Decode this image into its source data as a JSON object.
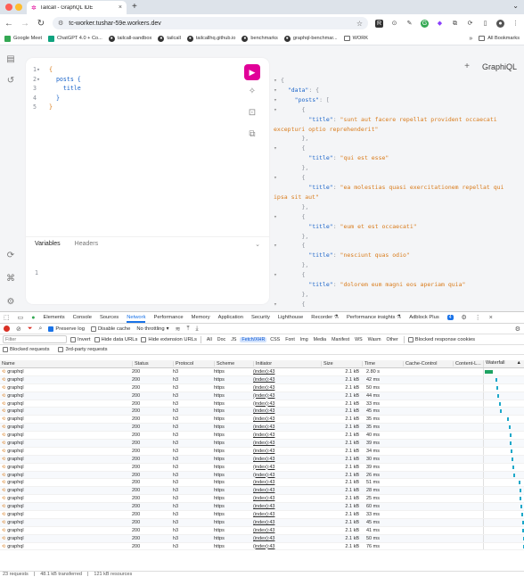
{
  "browser": {
    "tab_title": "Tailcall - GraphQL IDE",
    "new_tab": "+",
    "url": "tc-worker.tushar-59e.workers.dev",
    "bookmarks": [
      "Google Meet",
      "ChatGPT 4.0 + Co...",
      "tailcall-sandbox",
      "tailcall",
      "tailcallhq.github.io",
      "benchmarks",
      "graphql-benchmar...",
      "WORK"
    ],
    "all_bookmarks": "All Bookmarks",
    "colors": {
      "close": "#ff5f57",
      "min": "#febc2e",
      "max": "#28c840",
      "accent": "#e10098"
    }
  },
  "graphiql": {
    "brand": "GraphiQL",
    "add_tab": "+",
    "run_icon": "▶",
    "query_lines": [
      {
        "num": "1",
        "fold": "▾",
        "text": "{",
        "kind": "brace",
        "indent": ""
      },
      {
        "num": "2",
        "fold": "▾",
        "text": "posts {",
        "kind": "field",
        "indent": "  "
      },
      {
        "num": "3",
        "fold": "",
        "text": "title",
        "kind": "field",
        "indent": "    "
      },
      {
        "num": "4",
        "fold": "",
        "text": "}",
        "kind": "field",
        "indent": "  "
      },
      {
        "num": "5",
        "fold": "",
        "text": "}",
        "kind": "brace",
        "indent": ""
      }
    ],
    "variables_tab": "Variables",
    "headers_tab": "Headers",
    "variables_line": "1",
    "result_lines": [
      {
        "fold": "▾",
        "indent": "",
        "key": "",
        "val": "",
        "punct": "{"
      },
      {
        "fold": "▾",
        "indent": "  ",
        "key": "\"data\"",
        "val": "",
        "punct": ": {"
      },
      {
        "fold": "▾",
        "indent": "    ",
        "key": "\"posts\"",
        "val": "",
        "punct": ": ["
      },
      {
        "fold": "▾",
        "indent": "      ",
        "key": "",
        "val": "",
        "punct": "{"
      },
      {
        "fold": "",
        "indent": "        ",
        "key": "\"title\"",
        "val": "\"sunt aut facere repellat provident occaecati excepturi optio reprehenderit\"",
        "punct": ": "
      },
      {
        "fold": "",
        "indent": "      ",
        "key": "",
        "val": "",
        "punct": "},"
      },
      {
        "fold": "▾",
        "indent": "      ",
        "key": "",
        "val": "",
        "punct": "{"
      },
      {
        "fold": "",
        "indent": "        ",
        "key": "\"title\"",
        "val": "\"qui est esse\"",
        "punct": ": "
      },
      {
        "fold": "",
        "indent": "      ",
        "key": "",
        "val": "",
        "punct": "},"
      },
      {
        "fold": "▾",
        "indent": "      ",
        "key": "",
        "val": "",
        "punct": "{"
      },
      {
        "fold": "",
        "indent": "        ",
        "key": "\"title\"",
        "val": "\"ea molestias quasi exercitationem repellat qui ipsa sit aut\"",
        "punct": ": "
      },
      {
        "fold": "",
        "indent": "      ",
        "key": "",
        "val": "",
        "punct": "},"
      },
      {
        "fold": "▾",
        "indent": "      ",
        "key": "",
        "val": "",
        "punct": "{"
      },
      {
        "fold": "",
        "indent": "        ",
        "key": "\"title\"",
        "val": "\"eum et est occaecati\"",
        "punct": ": "
      },
      {
        "fold": "",
        "indent": "      ",
        "key": "",
        "val": "",
        "punct": "},"
      },
      {
        "fold": "▾",
        "indent": "      ",
        "key": "",
        "val": "",
        "punct": "{"
      },
      {
        "fold": "",
        "indent": "        ",
        "key": "\"title\"",
        "val": "\"nesciunt quas odio\"",
        "punct": ": "
      },
      {
        "fold": "",
        "indent": "      ",
        "key": "",
        "val": "",
        "punct": "},"
      },
      {
        "fold": "▾",
        "indent": "      ",
        "key": "",
        "val": "",
        "punct": "{"
      },
      {
        "fold": "",
        "indent": "        ",
        "key": "\"title\"",
        "val": "\"dolorem eum magni eos aperiam quia\"",
        "punct": ": "
      },
      {
        "fold": "",
        "indent": "      ",
        "key": "",
        "val": "",
        "punct": "},"
      },
      {
        "fold": "▾",
        "indent": "      ",
        "key": "",
        "val": "",
        "punct": "{"
      },
      {
        "fold": "",
        "indent": "        ",
        "key": "\"title\"",
        "val": "\"magnam facilis autem\"",
        "punct": ": "
      }
    ]
  },
  "devtools": {
    "tabs": [
      "Elements",
      "Console",
      "Sources",
      "Network",
      "Performance",
      "Memory",
      "Application",
      "Security",
      "Lighthouse",
      "Recorder ⚗",
      "Performance insights ⚗",
      "Adblock Plus"
    ],
    "active_tab": "Network",
    "badge": "4",
    "preserve_log": "Preserve log",
    "disable_cache": "Disable cache",
    "throttling": "No throttling",
    "filter_placeholder": "Filter",
    "invert": "Invert",
    "hide_data_urls": "Hide data URLs",
    "hide_ext_urls": "Hide extension URLs",
    "type_filters": [
      "All",
      "Doc",
      "JS",
      "Fetch/XHR",
      "CSS",
      "Font",
      "Img",
      "Media",
      "Manifest",
      "WS",
      "Wasm",
      "Other"
    ],
    "active_type": "Fetch/XHR",
    "blocked_cookies": "Blocked response cookies",
    "blocked_requests": "Blocked requests",
    "third_party": "3rd-party requests",
    "columns": [
      "Name",
      "Status",
      "Protocol",
      "Scheme",
      "Initiator",
      "Size",
      "Time",
      "Cache-Control",
      "Content-L...",
      "Waterfall"
    ],
    "requests": [
      {
        "name": "graphql",
        "status": "200",
        "protocol": "h3",
        "scheme": "https",
        "initiator": "(index):43",
        "size": "2.1 kB",
        "time": "2.80 s",
        "wf_start": 0.02,
        "wf_len": 0.2
      },
      {
        "name": "graphql",
        "status": "200",
        "protocol": "h3",
        "scheme": "https",
        "initiator": "(index):43",
        "size": "2.1 kB",
        "time": "42 ms",
        "wf_start": 0.28,
        "wf_len": 0.04
      },
      {
        "name": "graphql",
        "status": "200",
        "protocol": "h3",
        "scheme": "https",
        "initiator": "(index):43",
        "size": "2.1 kB",
        "time": "50 ms",
        "wf_start": 0.3,
        "wf_len": 0.04
      },
      {
        "name": "graphql",
        "status": "200",
        "protocol": "h3",
        "scheme": "https",
        "initiator": "(index):43",
        "size": "2.1 kB",
        "time": "44 ms",
        "wf_start": 0.33,
        "wf_len": 0.04
      },
      {
        "name": "graphql",
        "status": "200",
        "protocol": "h3",
        "scheme": "https",
        "initiator": "(index):43",
        "size": "2.1 kB",
        "time": "33 ms",
        "wf_start": 0.36,
        "wf_len": 0.04
      },
      {
        "name": "graphql",
        "status": "200",
        "protocol": "h3",
        "scheme": "https",
        "initiator": "(index):43",
        "size": "2.1 kB",
        "time": "45 ms",
        "wf_start": 0.4,
        "wf_len": 0.04
      },
      {
        "name": "graphql",
        "status": "200",
        "protocol": "h3",
        "scheme": "https",
        "initiator": "(index):43",
        "size": "2.1 kB",
        "time": "35 ms",
        "wf_start": 0.56,
        "wf_len": 0.04
      },
      {
        "name": "graphql",
        "status": "200",
        "protocol": "h3",
        "scheme": "https",
        "initiator": "(index):43",
        "size": "2.1 kB",
        "time": "35 ms",
        "wf_start": 0.6,
        "wf_len": 0.04
      },
      {
        "name": "graphql",
        "status": "200",
        "protocol": "h3",
        "scheme": "https",
        "initiator": "(index):43",
        "size": "2.1 kB",
        "time": "40 ms",
        "wf_start": 0.62,
        "wf_len": 0.04
      },
      {
        "name": "graphql",
        "status": "200",
        "protocol": "h3",
        "scheme": "https",
        "initiator": "(index):43",
        "size": "2.1 kB",
        "time": "39 ms",
        "wf_start": 0.64,
        "wf_len": 0.04
      },
      {
        "name": "graphql",
        "status": "200",
        "protocol": "h3",
        "scheme": "https",
        "initiator": "(index):43",
        "size": "2.1 kB",
        "time": "34 ms",
        "wf_start": 0.66,
        "wf_len": 0.04
      },
      {
        "name": "graphql",
        "status": "200",
        "protocol": "h3",
        "scheme": "https",
        "initiator": "(index):43",
        "size": "2.1 kB",
        "time": "30 ms",
        "wf_start": 0.68,
        "wf_len": 0.04
      },
      {
        "name": "graphql",
        "status": "200",
        "protocol": "h3",
        "scheme": "https",
        "initiator": "(index):43",
        "size": "2.1 kB",
        "time": "39 ms",
        "wf_start": 0.7,
        "wf_len": 0.04
      },
      {
        "name": "graphql",
        "status": "200",
        "protocol": "h3",
        "scheme": "https",
        "initiator": "(index):43",
        "size": "2.1 kB",
        "time": "26 ms",
        "wf_start": 0.72,
        "wf_len": 0.04
      },
      {
        "name": "graphql",
        "status": "200",
        "protocol": "h3",
        "scheme": "https",
        "initiator": "(index):43",
        "size": "2.1 kB",
        "time": "51 ms",
        "wf_start": 0.84,
        "wf_len": 0.04
      },
      {
        "name": "graphql",
        "status": "200",
        "protocol": "h3",
        "scheme": "https",
        "initiator": "(index):43",
        "size": "2.1 kB",
        "time": "28 ms",
        "wf_start": 0.86,
        "wf_len": 0.04
      },
      {
        "name": "graphql",
        "status": "200",
        "protocol": "h3",
        "scheme": "https",
        "initiator": "(index):43",
        "size": "2.1 kB",
        "time": "25 ms",
        "wf_start": 0.88,
        "wf_len": 0.04
      },
      {
        "name": "graphql",
        "status": "200",
        "protocol": "h3",
        "scheme": "https",
        "initiator": "(index):43",
        "size": "2.1 kB",
        "time": "60 ms",
        "wf_start": 0.9,
        "wf_len": 0.04
      },
      {
        "name": "graphql",
        "status": "200",
        "protocol": "h3",
        "scheme": "https",
        "initiator": "(index):43",
        "size": "2.1 kB",
        "time": "33 ms",
        "wf_start": 0.92,
        "wf_len": 0.04
      },
      {
        "name": "graphql",
        "status": "200",
        "protocol": "h3",
        "scheme": "https",
        "initiator": "(index):43",
        "size": "2.1 kB",
        "time": "45 ms",
        "wf_start": 0.93,
        "wf_len": 0.04
      },
      {
        "name": "graphql",
        "status": "200",
        "protocol": "h3",
        "scheme": "https",
        "initiator": "(index):43",
        "size": "2.1 kB",
        "time": "41 ms",
        "wf_start": 0.94,
        "wf_len": 0.04
      },
      {
        "name": "graphql",
        "status": "200",
        "protocol": "h3",
        "scheme": "https",
        "initiator": "(index):43",
        "size": "2.1 kB",
        "time": "50 ms",
        "wf_start": 0.95,
        "wf_len": 0.04
      },
      {
        "name": "graphql",
        "status": "200",
        "protocol": "h3",
        "scheme": "https",
        "initiator": "(index):43",
        "size": "2.1 kB",
        "time": "76 ms",
        "wf_start": 0.96,
        "wf_len": 0.04
      }
    ],
    "status_bar": [
      "23 requests",
      "48.1 kB transferred",
      "121 kB resources"
    ]
  }
}
